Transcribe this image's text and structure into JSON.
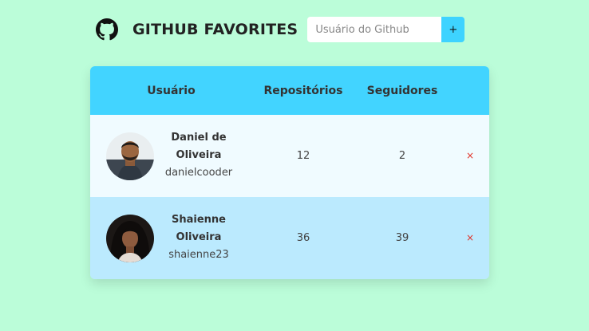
{
  "header": {
    "title": "GITHUB FAVORITES",
    "logo_icon": "github-icon"
  },
  "search": {
    "placeholder": "Usuário do Github",
    "value": "",
    "button_label": "+",
    "button_color": "#3ed3ff"
  },
  "table": {
    "columns": [
      "Usuário",
      "Repositórios",
      "Seguidores"
    ],
    "header_color": "#42d4ff",
    "rows": [
      {
        "name": "Daniel de Oliveira",
        "login": "danielcooder",
        "repositories": "12",
        "followers": "2",
        "remove_label": "×"
      },
      {
        "name": "Shaienne Oliveira",
        "login": "shaienne23",
        "repositories": "36",
        "followers": "39",
        "remove_label": "×"
      }
    ]
  },
  "colors": {
    "background": "#bbfdd9",
    "row_odd": "#f0fbff",
    "row_even": "#bbeafe",
    "remove": "#e0342a"
  }
}
